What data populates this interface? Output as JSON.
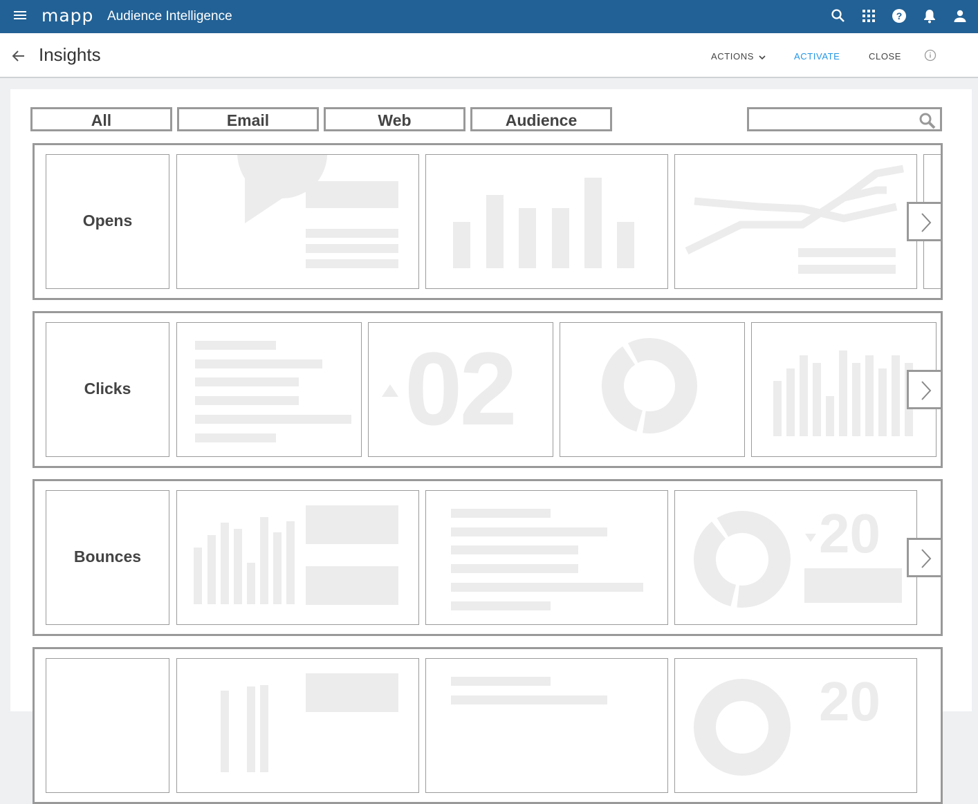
{
  "appbar": {
    "logo": "mapp",
    "title": "Audience Intelligence",
    "icons": [
      "menu-icon",
      "search-icon",
      "apps-grid-icon",
      "help-icon",
      "notifications-icon",
      "account-icon"
    ]
  },
  "header": {
    "title": "Insights",
    "actions_label": "ACTIONS",
    "activate_label": "ACTIVATE",
    "close_label": "CLOSE"
  },
  "tabs": [
    "All",
    "Email",
    "Web",
    "Audience"
  ],
  "search": {
    "placeholder": ""
  },
  "rows": [
    {
      "label": "Opens"
    },
    {
      "label": "Clicks",
      "kpi_number": "02"
    },
    {
      "label": "Bounces",
      "kpi_number": "20"
    },
    {
      "label": "",
      "kpi_number": "20"
    }
  ],
  "colors": {
    "appbar": "#226195",
    "activate": "#2196e6",
    "placeholder": "#ececec",
    "border": "#999999"
  }
}
